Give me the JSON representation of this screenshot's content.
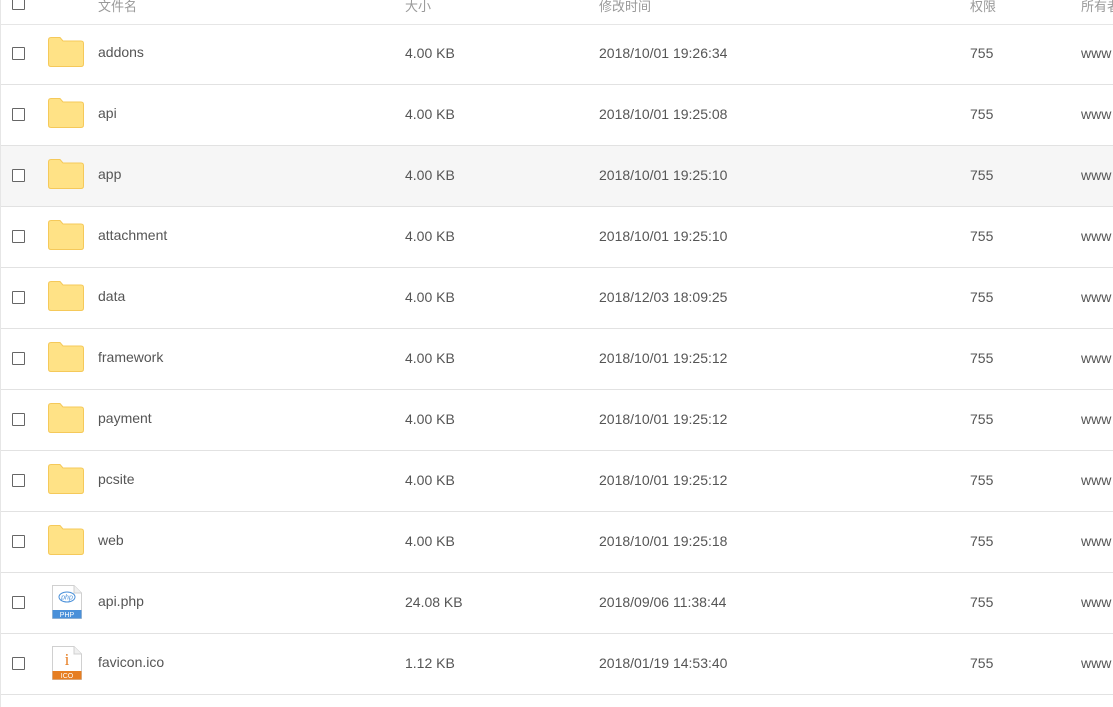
{
  "columns": {
    "name": "文件名",
    "size": "大小",
    "modified": "修改时间",
    "permission": "权限",
    "owner": "所有者"
  },
  "files": [
    {
      "name": "addons",
      "type": "folder",
      "size": "4.00 KB",
      "modified": "2018/10/01 19:26:34",
      "permission": "755",
      "owner": "www"
    },
    {
      "name": "api",
      "type": "folder",
      "size": "4.00 KB",
      "modified": "2018/10/01 19:25:08",
      "permission": "755",
      "owner": "www"
    },
    {
      "name": "app",
      "type": "folder",
      "size": "4.00 KB",
      "modified": "2018/10/01 19:25:10",
      "permission": "755",
      "owner": "www"
    },
    {
      "name": "attachment",
      "type": "folder",
      "size": "4.00 KB",
      "modified": "2018/10/01 19:25:10",
      "permission": "755",
      "owner": "www"
    },
    {
      "name": "data",
      "type": "folder",
      "size": "4.00 KB",
      "modified": "2018/12/03 18:09:25",
      "permission": "755",
      "owner": "www"
    },
    {
      "name": "framework",
      "type": "folder",
      "size": "4.00 KB",
      "modified": "2018/10/01 19:25:12",
      "permission": "755",
      "owner": "www"
    },
    {
      "name": "payment",
      "type": "folder",
      "size": "4.00 KB",
      "modified": "2018/10/01 19:25:12",
      "permission": "755",
      "owner": "www"
    },
    {
      "name": "pcsite",
      "type": "folder",
      "size": "4.00 KB",
      "modified": "2018/10/01 19:25:12",
      "permission": "755",
      "owner": "www"
    },
    {
      "name": "web",
      "type": "folder",
      "size": "4.00 KB",
      "modified": "2018/10/01 19:25:18",
      "permission": "755",
      "owner": "www"
    },
    {
      "name": "api.php",
      "type": "php",
      "icon_text": "php",
      "icon_badge": "PHP",
      "size": "24.08 KB",
      "modified": "2018/09/06 11:38:44",
      "permission": "755",
      "owner": "www"
    },
    {
      "name": "favicon.ico",
      "type": "ico",
      "icon_text": "i",
      "icon_badge": "ICO",
      "size": "1.12 KB",
      "modified": "2018/01/19 14:53:40",
      "permission": "755",
      "owner": "www"
    }
  ],
  "hovered_row": 2,
  "colors": {
    "folder_fill": "#ffe286",
    "folder_stroke": "#f5c95a",
    "php_accent": "#4a90d9",
    "ico_accent": "#e67e22",
    "row_hover": "#f6f6f6"
  }
}
